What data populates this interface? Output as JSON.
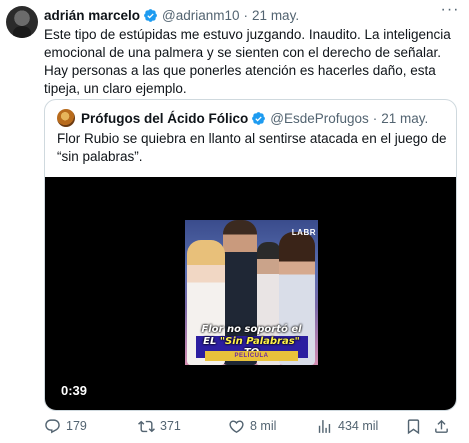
{
  "tweet": {
    "author_name": "adrián marcelo",
    "handle": "@adrianm10",
    "separator": "·",
    "date": "21 may.",
    "more_label": "···",
    "text": "Este tipo de estúpidas me estuvo juzgando. Inaudito. La inteligencia emocional de una palmera y se sienten con el derecho de señalar. Hay personas a las que ponerles atención es hacerles daño, esta tipeja, un claro ejemplo."
  },
  "quote": {
    "author_name": "Prófugos del Ácido Fólico",
    "handle": "@EsdeProfugos",
    "separator": "·",
    "date": "21 may.",
    "text": "Flor Rubio se quiebra en llanto al sentirse atacada en el juego de “sin palabras”.",
    "video": {
      "duration": "0:39",
      "caption_line1": "Flor no soportó el",
      "caption_line2_prefix": "EL",
      "caption_line2_highlight": "\"Sin Palabras\"",
      "caption_line2_suffix": "TO",
      "caption_tag": "PELÍCULA",
      "background_sign": "LABR"
    }
  },
  "actions": {
    "replies": "179",
    "retweets": "371",
    "likes": "8 mil",
    "views": "434 mil"
  },
  "colors": {
    "verified_blue": "#1d9bf0",
    "text_primary": "#0f1419",
    "text_secondary": "#536471",
    "border": "#cfd9de"
  },
  "icons": {
    "verified": "verified-badge-icon",
    "reply": "reply-icon",
    "retweet": "retweet-icon",
    "like": "heart-icon",
    "views": "views-chart-icon",
    "bookmark": "bookmark-icon",
    "share": "share-icon",
    "more": "more-dots-icon"
  }
}
